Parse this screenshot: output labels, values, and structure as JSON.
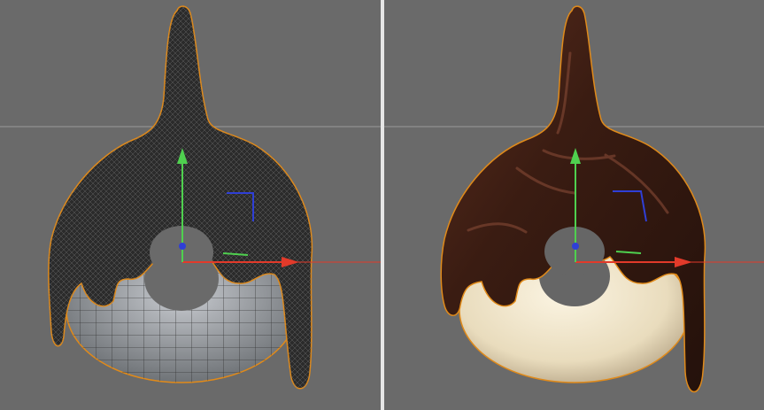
{
  "app": {
    "title": ""
  },
  "viewports": [
    {
      "id": "left",
      "display_mode": "wireframe",
      "object": "donut-with-chocolate-glaze",
      "colors": {
        "background": "#6a6a6a",
        "horizon_line": "#9a9a9a",
        "glaze": "#2b2b2b",
        "glaze_wire": "#777777",
        "donut": "#a8acb0",
        "donut_wire": "#2f2f2f",
        "selection_outline": "#e08a1a"
      },
      "axes": {
        "x_color": "#e23a2a",
        "y_color": "#4fd04f",
        "z_color": "#2f3fd6",
        "handle_x": "arrow",
        "handle_y": "arrow",
        "origin": "blue-dot"
      }
    },
    {
      "id": "right",
      "display_mode": "shaded",
      "object": "donut-with-chocolate-glaze",
      "colors": {
        "background": "#666666",
        "horizon_line": "#9a9a9a",
        "glaze": "#3a1c12",
        "glaze_highlight": "#7a4330",
        "donut": "#f2e6c8",
        "donut_shadow": "#c9b79a",
        "selection_outline": "#e08a1a"
      },
      "axes": {
        "x_color": "#e23a2a",
        "y_color": "#4fd04f",
        "z_color": "#2f3fd6",
        "handle_x": "arrow",
        "handle_y": "arrow",
        "origin": "blue-dot"
      }
    }
  ]
}
